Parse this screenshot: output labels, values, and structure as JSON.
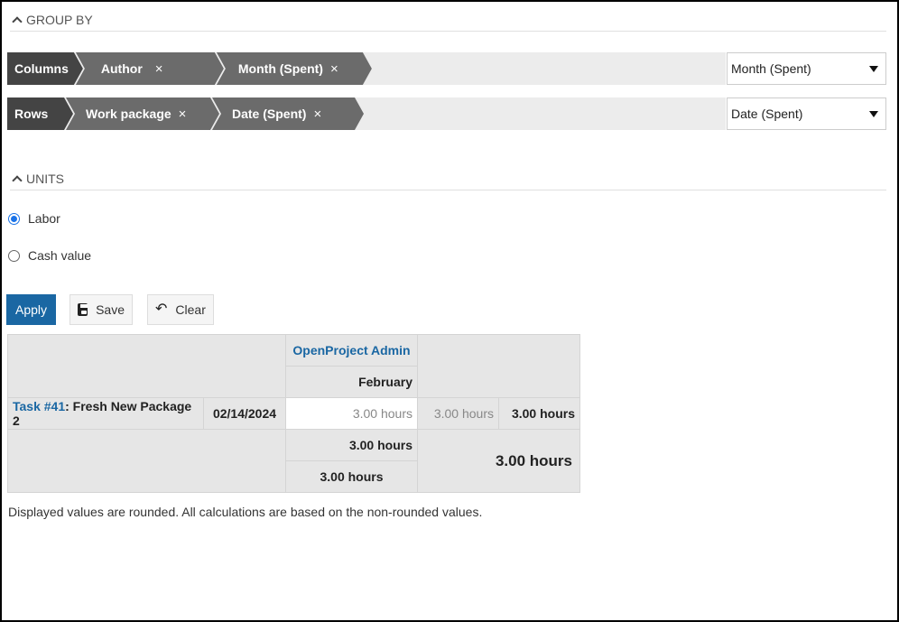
{
  "group_by": {
    "title": "GROUP BY",
    "columns": {
      "label": "Columns",
      "items": [
        "Author",
        "Month (Spent)"
      ],
      "select_value": "Month (Spent)"
    },
    "rows": {
      "label": "Rows",
      "items": [
        "Work package",
        "Date (Spent)"
      ],
      "select_value": "Date (Spent)"
    },
    "remove_glyph": "×"
  },
  "units": {
    "title": "UNITS",
    "options": [
      {
        "label": "Labor",
        "checked": true
      },
      {
        "label": "Cash value",
        "checked": false
      }
    ]
  },
  "actions": {
    "apply": "Apply",
    "save": "Save",
    "clear": "Clear"
  },
  "report": {
    "author": "OpenProject Admin",
    "month": "February",
    "row": {
      "task_link": "Task #41",
      "task_rest": ": Fresh New Package 2",
      "date": "02/14/2024",
      "cell_value": "3.00 hours",
      "author_total": "3.00 hours",
      "row_total": "3.00 hours"
    },
    "footer": {
      "month_total": "3.00 hours",
      "author_total": "3.00 hours",
      "grand_total": "3.00 hours"
    }
  },
  "note": "Displayed values are rounded. All calculations are based on the non-rounded values.",
  "colors": {
    "accent": "#1a67a3",
    "chip_dark": "#444444",
    "chip_item": "#6b6b6b"
  }
}
